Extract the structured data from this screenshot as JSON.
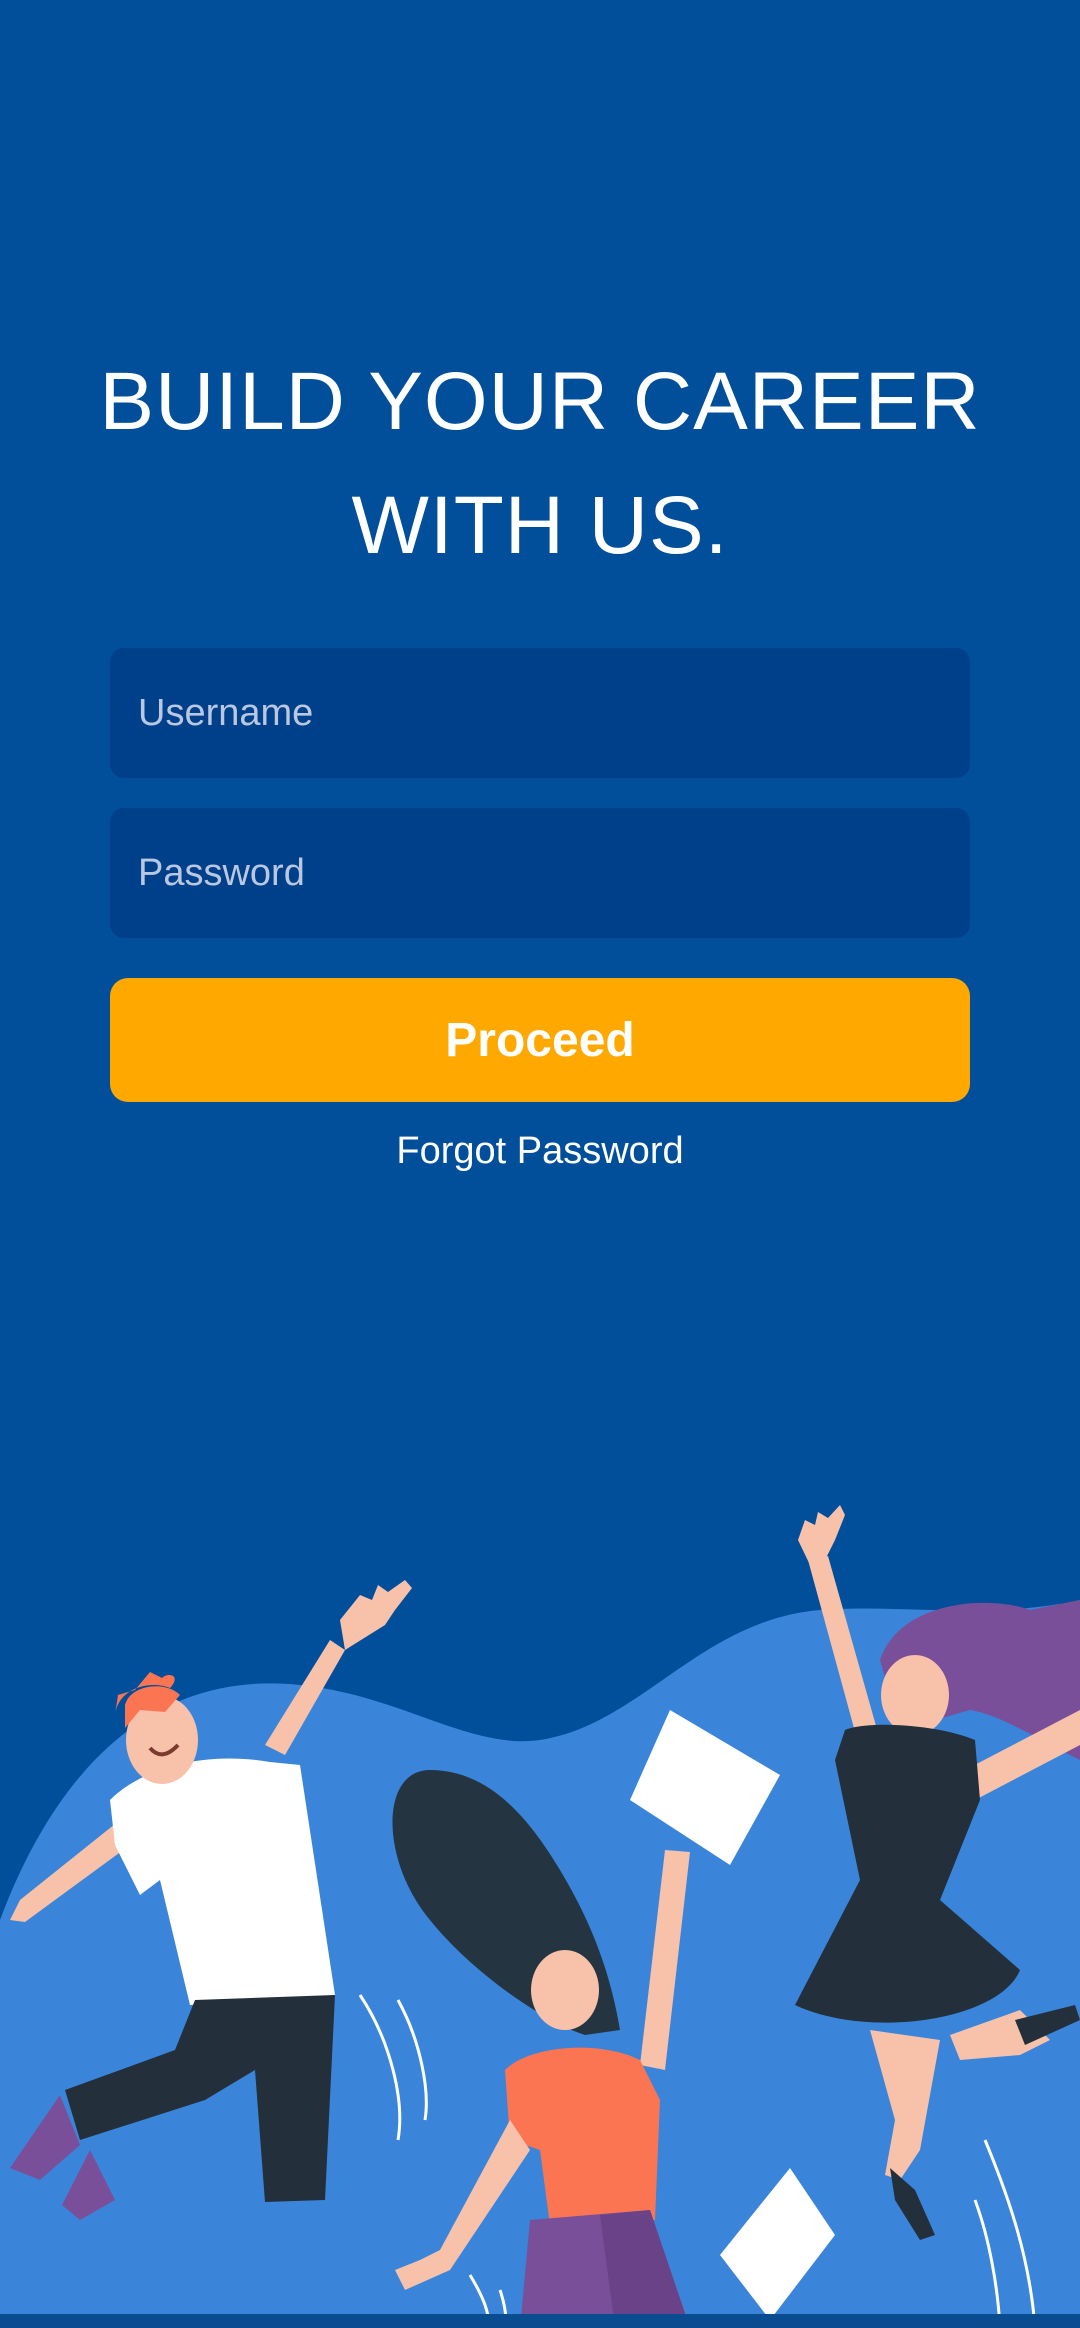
{
  "headline": {
    "line1": "BUILD YOUR CAREER",
    "line2": "WITH US."
  },
  "form": {
    "username_placeholder": "Username",
    "password_placeholder": "Password",
    "proceed_label": "Proceed",
    "forgot_label": "Forgot Password"
  },
  "colors": {
    "background": "#014f9b",
    "field_background": "#00408a",
    "accent": "#ffa800",
    "wave": "#3a85d9"
  },
  "illustration": {
    "description_icon": "people-jumping-illustration"
  }
}
